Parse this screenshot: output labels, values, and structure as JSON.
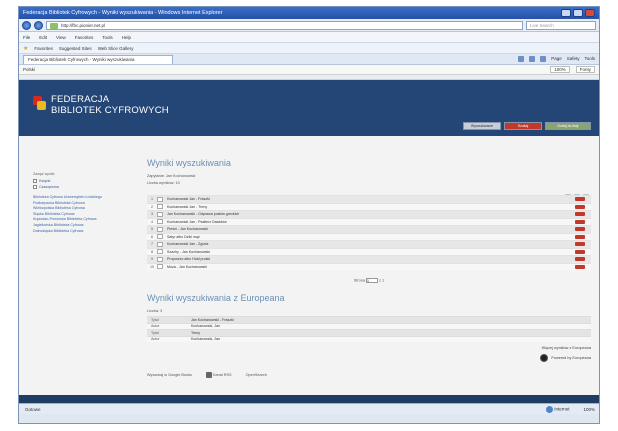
{
  "window": {
    "title": "Federacja Bibliotek Cyfrowych - Wyniki wyszukiwania - Windows Internet Explorer"
  },
  "toolbar": {
    "address": "http://fbc.pionier.net.pl",
    "search_placeholder": "Live Search"
  },
  "menu": {
    "items": [
      "File",
      "Edit",
      "View",
      "Favorites",
      "Tools",
      "Help"
    ]
  },
  "favorites": {
    "label": "Favorites",
    "items": [
      "Suggested Sites",
      "Web Slice Gallery"
    ]
  },
  "tab": {
    "label": "Federacja Bibliotek Cyfrowych - Wyniki wyszukiwania"
  },
  "tools": {
    "items": [
      "Page",
      "Safety",
      "Tools"
    ]
  },
  "subtoolbar": {
    "left": "Polski",
    "right": [
      "100%",
      "Fonty"
    ]
  },
  "site": {
    "brand_line1": "FEDERACJA",
    "brand_line2": "BIBLIOTEK CYFROWYCH",
    "nav": [
      "Wyszukiwanie",
      "Szukaj",
      "Dodaj do listy"
    ]
  },
  "sidebar": {
    "label": "Zawęź wyniki",
    "checks": [
      "Książki",
      "Czasopisma"
    ],
    "links": [
      "Biblioteka Cyfrowa Uniwersytetu Łódzkiego",
      "Podkarpacka Biblioteka Cyfrowa",
      "Wielkopolska Biblioteka Cyfrowa",
      "Śląska Biblioteka Cyfrowa",
      "Kujawsko-Pomorska Biblioteka Cyfrowa",
      "Jagiellońska Biblioteka Cyfrowa",
      "Dolnośląska Biblioteka Cyfrowa"
    ]
  },
  "main": {
    "title": "Wyniki wyszukiwania",
    "meta1": "Zapytanie: Jan Kochanowski",
    "meta2": "Liczba wyników: 10",
    "results": [
      {
        "no": "1",
        "title": "Kochanowski Jan - Fraszki"
      },
      {
        "no": "2",
        "title": "Kochanowski Jan - Treny"
      },
      {
        "no": "3",
        "title": "Jan Kochanowski - Odprawa posłów greckich"
      },
      {
        "no": "4",
        "title": "Kochanowski Jan - Psałterz Dawidów"
      },
      {
        "no": "5",
        "title": "Pieśni - Jan Kochanowski"
      },
      {
        "no": "6",
        "title": "Satyr albo Dziki mąż"
      },
      {
        "no": "7",
        "title": "Kochanowski Jan - Zgoda"
      },
      {
        "no": "8",
        "title": "Szachy - Jan Kochanowski"
      },
      {
        "no": "9",
        "title": "Proporzec albo Hołd pruski"
      },
      {
        "no": "10",
        "title": "Muza - Jan Kochanowski"
      }
    ],
    "pager_label": "Strona",
    "pager_value": "1",
    "pager_total": "z 1"
  },
  "europeana": {
    "title": "Wyniki wyszukiwania z Europeana",
    "count": "Liczba: 3",
    "rows": [
      {
        "k": "Tytuł",
        "v": "Jan Kochanowski - Fraszki"
      },
      {
        "k": "Autor",
        "v": "Kochanowski, Jan"
      },
      {
        "k": "Tytuł",
        "v": "Treny"
      },
      {
        "k": "Autor",
        "v": "Kochanowski, Jan"
      }
    ],
    "more_link": "Więcej wyników z Europeana",
    "powered": "Powered by Europeana"
  },
  "bottom": {
    "links": [
      "Wyszukaj w Google Books",
      "Kanał RSS",
      "OpenSearch"
    ]
  },
  "status": {
    "text": "Gotowe",
    "zone": "Internet",
    "zoom": "100%"
  }
}
